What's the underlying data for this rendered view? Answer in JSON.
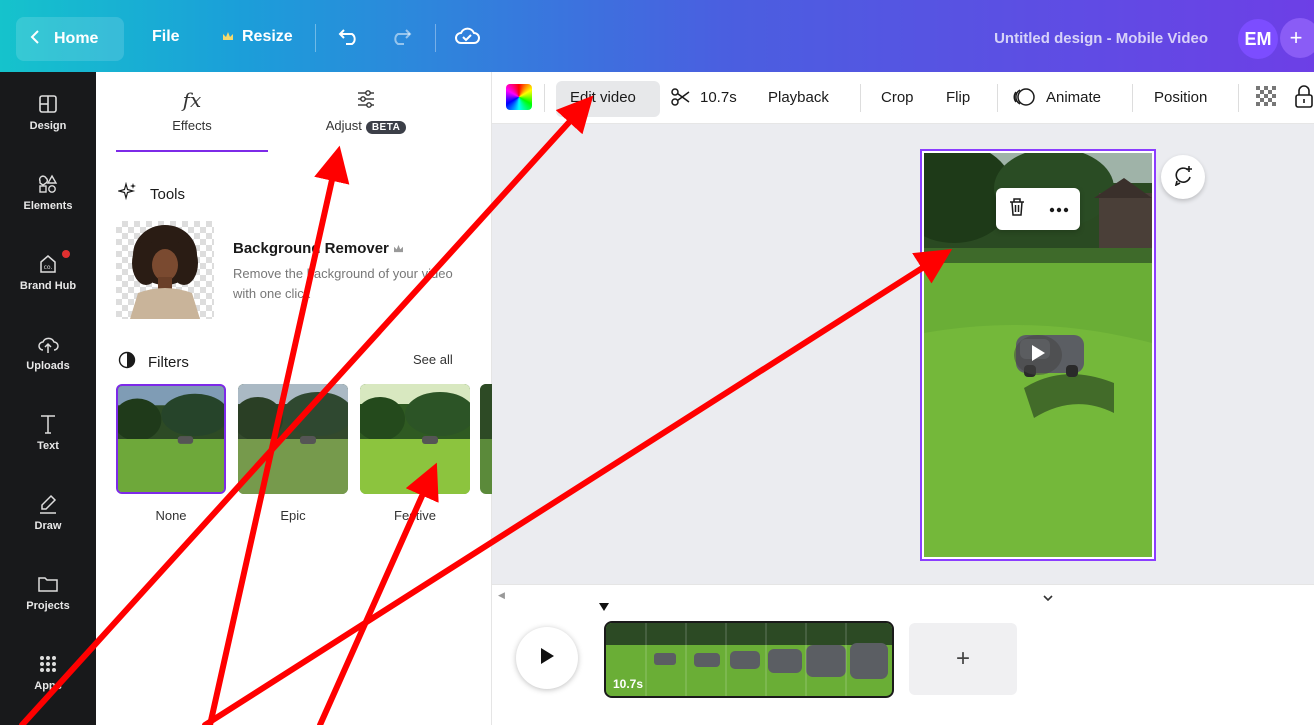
{
  "topbar": {
    "home_label": "Home",
    "file_label": "File",
    "resize_label": "Resize",
    "title": "Untitled design - Mobile Video",
    "avatar_initials": "EM",
    "plus_symbol": "+"
  },
  "rail": {
    "items": [
      {
        "label": "Design",
        "icon": "layout-icon"
      },
      {
        "label": "Elements",
        "icon": "shapes-icon"
      },
      {
        "label": "Brand Hub",
        "icon": "brand-icon"
      },
      {
        "label": "Uploads",
        "icon": "cloud-upload-icon"
      },
      {
        "label": "Text",
        "icon": "text-icon"
      },
      {
        "label": "Draw",
        "icon": "pen-icon"
      },
      {
        "label": "Projects",
        "icon": "folder-icon"
      },
      {
        "label": "Apps",
        "icon": "grid-icon"
      }
    ]
  },
  "panel": {
    "tabs": [
      {
        "label": "Effects",
        "icon": "fx-icon",
        "glyph": "fx"
      },
      {
        "label": "Adjust",
        "icon": "sliders-icon",
        "badge": "BETA"
      }
    ],
    "tools_title": "Tools",
    "bg_remover": {
      "title": "Background Remover",
      "description": "Remove the background of your video with one click"
    },
    "filters_title": "Filters",
    "see_all_label": "See all",
    "filters": [
      {
        "label": "None",
        "selected": true
      },
      {
        "label": "Epic",
        "selected": false
      },
      {
        "label": "Festive",
        "selected": false
      }
    ]
  },
  "context_toolbar": {
    "edit_video_label": "Edit video",
    "duration_label": "10.7s",
    "playback_label": "Playback",
    "crop_label": "Crop",
    "flip_label": "Flip",
    "animate_label": "Animate",
    "position_label": "Position"
  },
  "timeline": {
    "clip_duration": "10.7s",
    "add_symbol": "+"
  },
  "colors": {
    "accent": "#7d2ae8",
    "annotation_arrow": "#ff0000",
    "rail_bg": "#18191b"
  }
}
